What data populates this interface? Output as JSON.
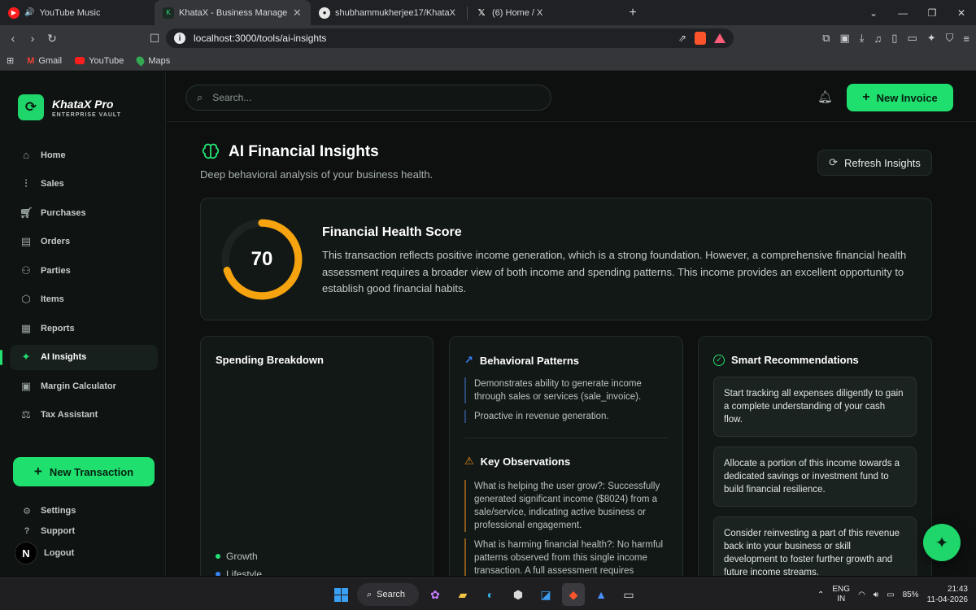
{
  "browser": {
    "tabs": [
      {
        "title": "YouTube Music",
        "favicon": "youtube-music-icon",
        "active": false
      },
      {
        "title": "KhataX - Business Management",
        "favicon": "khatax-icon",
        "active": true
      },
      {
        "title": "shubhammukherjee17/KhataX",
        "favicon": "github-icon",
        "active": false
      },
      {
        "title": "(6) Home / X",
        "favicon": "x-icon",
        "active": false
      }
    ],
    "url": "localhost:3000/tools/ai-insights",
    "bookmarks": [
      {
        "label": "Gmail"
      },
      {
        "label": "YouTube"
      },
      {
        "label": "Maps"
      }
    ]
  },
  "app": {
    "brand": {
      "name": "KhataX Pro",
      "subtitle": "ENTERPRISE VAULT"
    },
    "nav": [
      {
        "label": "Home",
        "icon": "home-icon"
      },
      {
        "label": "Sales",
        "icon": "bar-chart-icon"
      },
      {
        "label": "Purchases",
        "icon": "cart-icon"
      },
      {
        "label": "Orders",
        "icon": "box-icon"
      },
      {
        "label": "Parties",
        "icon": "users-icon"
      },
      {
        "label": "Items",
        "icon": "package-icon"
      },
      {
        "label": "Reports",
        "icon": "file-icon"
      },
      {
        "label": "AI Insights",
        "icon": "sparkles-icon",
        "active": true
      },
      {
        "label": "Margin Calculator",
        "icon": "calculator-icon"
      },
      {
        "label": "Tax Assistant",
        "icon": "scale-icon"
      }
    ],
    "new_transaction_label": "New Transaction",
    "footer_nav": [
      {
        "label": "Settings",
        "icon": "gear-icon"
      },
      {
        "label": "Support",
        "icon": "help-icon"
      }
    ],
    "logout_label": "Logout",
    "avatar_letter": "N",
    "search_placeholder": "Search...",
    "new_invoice_label": "New Invoice",
    "accent_color": "#1fe06e"
  },
  "page": {
    "title": "AI Financial Insights",
    "subtitle": "Deep behavioral analysis of your business health.",
    "refresh_label": "Refresh Insights",
    "health": {
      "score": 70,
      "score_max": 100,
      "title": "Financial Health Score",
      "text": "This transaction reflects positive income generation, which is a strong foundation. However, a comprehensive financial health assessment requires a broader view of both income and spending patterns. This income provides an excellent opportunity to establish good financial habits."
    },
    "spending": {
      "title": "Spending Breakdown",
      "legend": [
        {
          "label": "Growth",
          "color": "#23e072"
        },
        {
          "label": "Lifestyle",
          "color": "#3b82f6"
        }
      ]
    },
    "behavior": {
      "title": "Behavioral Patterns",
      "patterns": [
        "Demonstrates ability to generate income through sales or services (sale_invoice).",
        "Proactive in revenue generation."
      ],
      "observations_title": "Key Observations",
      "observations": [
        "What is helping the user grow?: Successfully generated significant income ($8024) from a sale/service, indicating active business or professional engagement.",
        "What is harming financial health?: No harmful patterns observed from this single income transaction. A full assessment requires"
      ]
    },
    "recommendations": {
      "title": "Smart Recommendations",
      "items": [
        "Start tracking all expenses diligently to gain a complete understanding of your cash flow.",
        "Allocate a portion of this income towards a dedicated savings or investment fund to build financial resilience.",
        "Consider reinvesting a part of this revenue back into your business or skill development to foster further growth and future income streams."
      ]
    }
  },
  "taskbar": {
    "search_label": "Search",
    "lang_line1": "ENG",
    "lang_line2": "IN",
    "battery": "85%",
    "time": "21:43",
    "date": "11-04-2026"
  }
}
